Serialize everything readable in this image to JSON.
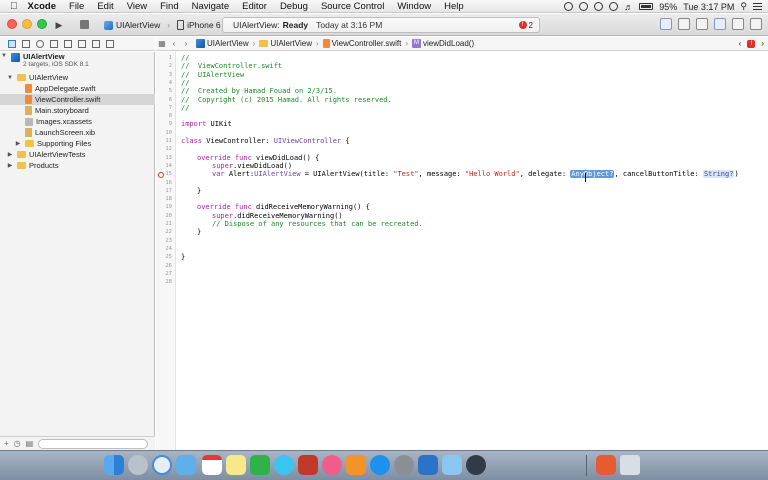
{
  "menubar": {
    "app_name": "Xcode",
    "items": [
      "File",
      "Edit",
      "View",
      "Find",
      "Navigate",
      "Editor",
      "Debug",
      "Source Control",
      "Window",
      "Help"
    ],
    "battery": "95%",
    "clock": "Tue 3:17 PM"
  },
  "toolbar": {
    "scheme": "UIAlertView",
    "device": "iPhone 6",
    "status_project": "UIAlertView:",
    "status_state": "Ready",
    "status_time": "Today at 3:16 PM",
    "error_count": "2"
  },
  "jumpbar": {
    "crumbs": [
      "UIAlertView",
      "UIAlertView",
      "ViewController.swift",
      "viewDidLoad()"
    ],
    "method_badge": "M"
  },
  "navigator": {
    "project_name": "UIAlertView",
    "project_subtitle": "2 targets, iOS SDK 8.1",
    "items": [
      {
        "label": "UIAlertView"
      },
      {
        "label": "AppDelegate.swift"
      },
      {
        "label": "ViewController.swift"
      },
      {
        "label": "Main.storyboard"
      },
      {
        "label": "Images.xcassets"
      },
      {
        "label": "LaunchScreen.xib"
      },
      {
        "label": "Supporting Files"
      },
      {
        "label": "UIAlertViewTests"
      },
      {
        "label": "Products"
      }
    ]
  },
  "editor": {
    "line_numbers": [
      "1",
      "2",
      "3",
      "4",
      "5",
      "6",
      "7",
      "8",
      "9",
      "10",
      "11",
      "12",
      "13",
      "14",
      "15",
      "16",
      "17",
      "18",
      "19",
      "20",
      "21",
      "22",
      "23",
      "24",
      "25",
      "26",
      "27",
      "28"
    ],
    "lines": {
      "l1": "//",
      "l2": "//  ViewController.swift",
      "l3": "//  UIAlertView",
      "l4": "//",
      "l5": "//  Created by Hamad Fouad on 2/3/15.",
      "l6": "//  Copyright (c) 2015 Hamad. All rights reserved.",
      "l7": "//",
      "l9_kw": "import",
      "l9_rest": " UIKit",
      "l11_kw": "class",
      "l11_name": " ViewController: ",
      "l11_type": "UIViewController",
      "l11_end": " {",
      "l13_kw": "override func",
      "l13_rest": " viewDidLoad() {",
      "l14_kw": "super",
      "l14_rest": ".viewDidLoad()",
      "l16_kw": "var",
      "l16_a": " Alert:",
      "l16_type": "UIAlertView",
      "l16_b": " = UIAlertView(title: ",
      "l16_s1": "\"Test\"",
      "l16_c": ", message: ",
      "l16_s2": "\"Hello World\"",
      "l16_d": ", delegate: ",
      "l16_ph1": "AnyObject?",
      "l16_e": ", cancelButtonTitle: ",
      "l16_ph2": "String?",
      "l16_f": ")",
      "l18": "}",
      "l20_kw": "override func",
      "l20_rest": " didReceiveMemoryWarning() {",
      "l21_kw": "super",
      "l21_rest": ".didReceiveMemoryWarning()",
      "l22": "// Dispose of any resources that can be recreated.",
      "l23": "}",
      "l26": "}"
    }
  },
  "colors": {
    "keyword": "#b01eaa",
    "comment": "#1d8b25",
    "type": "#6f41a7",
    "string": "#c4251d",
    "error": "#e0302a",
    "selection": "#d6d6d6"
  },
  "dock": {
    "icons": [
      "finder-icon",
      "launchpad-icon",
      "safari-icon",
      "mail-icon",
      "calendar-icon",
      "notes-icon",
      "facetime-icon",
      "messages-icon",
      "photo-booth-icon",
      "itunes-icon",
      "ibooks-icon",
      "app-store-icon",
      "system-preferences-icon",
      "xcode-icon",
      "preview-icon",
      "quicktime-icon",
      "app-icon",
      "trash-icon"
    ]
  }
}
